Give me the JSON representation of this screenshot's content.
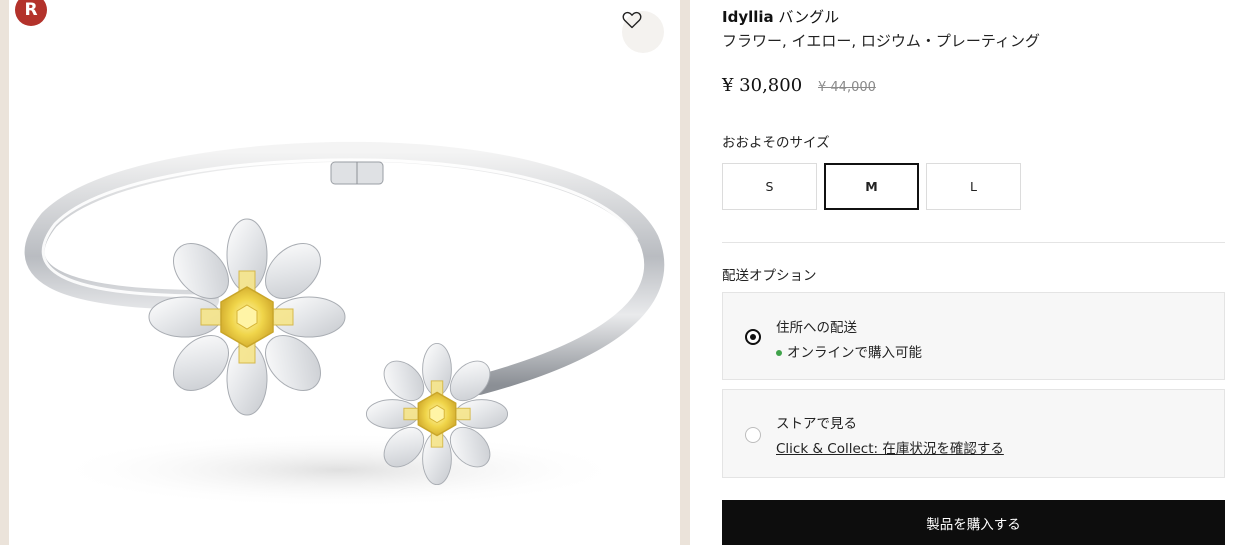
{
  "gallery": {
    "badge_letter": "R",
    "wishlist_icon": "heart-icon",
    "image_alt": "Idyllia bangle flower yellow"
  },
  "product": {
    "name_bold": "Idyllia",
    "name_rest": " バングル",
    "subtitle": "フラワー, イエロー, ロジウム・プレーティング",
    "price": "¥ 30,800",
    "old_price": "¥ 44,000"
  },
  "size": {
    "label": "おおよそのサイズ",
    "options": [
      "S",
      "M",
      "L"
    ],
    "selected": "M"
  },
  "delivery": {
    "label": "配送オプション",
    "options": [
      {
        "title": "住所への配送",
        "status": "オンラインで購入可能",
        "selected": true
      },
      {
        "title": "ストアで見る",
        "link": "Click & Collect: 在庫状況を確認する",
        "selected": false
      }
    ]
  },
  "buy_button": "製品を購入する",
  "colors": {
    "status_dot": "#3fa24a",
    "button_bg": "#0d0d0d",
    "badge": "#b3322b"
  }
}
